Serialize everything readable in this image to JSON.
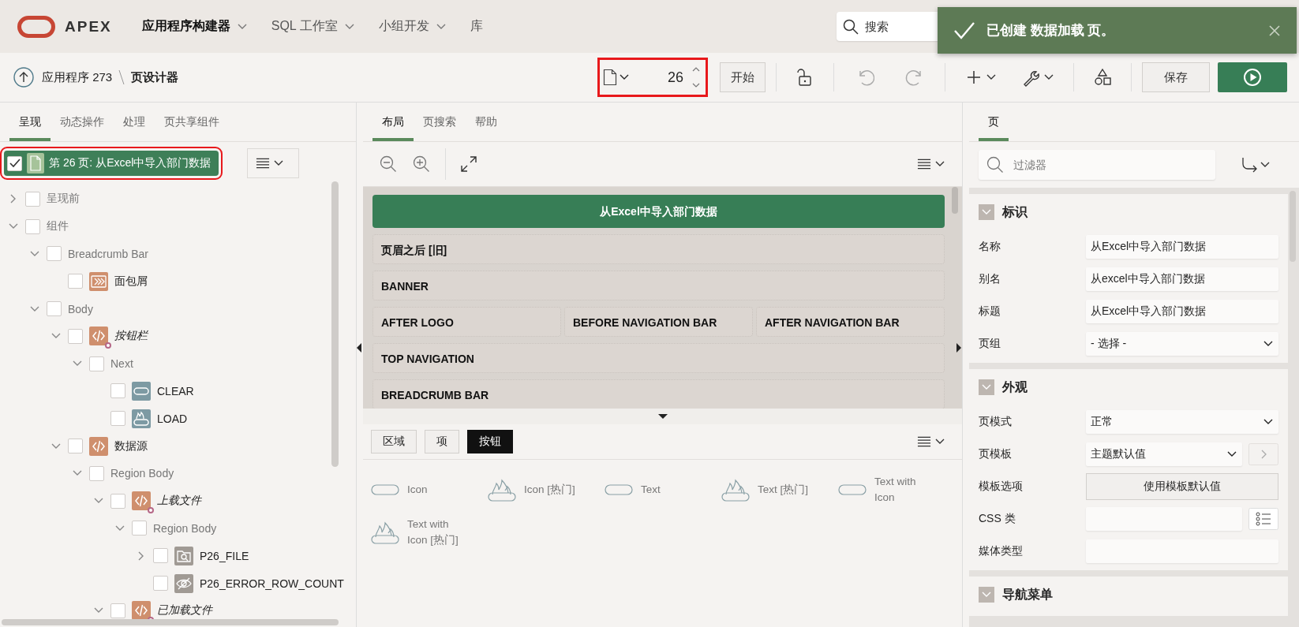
{
  "header": {
    "logo": "APEX",
    "nav": [
      {
        "label": "应用程序构建器",
        "selected": true,
        "menu": true
      },
      {
        "label": "SQL 工作室",
        "selected": false,
        "menu": true
      },
      {
        "label": "小组开发",
        "selected": false,
        "menu": true
      },
      {
        "label": "库",
        "selected": false,
        "menu": false
      }
    ],
    "search": {
      "placeholder": "搜索"
    }
  },
  "toast": {
    "message": "已创建 数据加载 页。"
  },
  "toolbar": {
    "breadcrumb": [
      "应用程序 273",
      "页设计器"
    ],
    "page_number": "26",
    "buttons": [
      {
        "kind": "text",
        "label": "开始"
      },
      {
        "kind": "lock"
      },
      {
        "kind": "undo",
        "disabled": true
      },
      {
        "kind": "redo",
        "disabled": true
      },
      {
        "kind": "add"
      },
      {
        "kind": "wrench"
      },
      {
        "kind": "shapes"
      },
      {
        "kind": "save",
        "label": "保存"
      },
      {
        "kind": "run"
      }
    ]
  },
  "left": {
    "tabs": [
      {
        "label": "呈现",
        "selected": true
      },
      {
        "label": "动态操作",
        "selected": false
      },
      {
        "label": "处理",
        "selected": false
      },
      {
        "label": "页共享组件",
        "selected": false
      }
    ],
    "root": {
      "label": "第 26 页: 从Excel中导入部门数据",
      "checked": true,
      "selected": true,
      "children": [
        {
          "label": "呈现前",
          "kind": "group",
          "checked": false,
          "expanded": false
        },
        {
          "label": "组件",
          "kind": "group",
          "checked": false,
          "expanded": true,
          "children": [
            {
              "label": "Breadcrumb Bar",
              "kind": "group",
              "checked": false,
              "expanded": true,
              "children": [
                {
                  "label": "面包屑",
                  "checked": false,
                  "kind": "breadcrumb"
                }
              ]
            },
            {
              "label": "Body",
              "kind": "group",
              "checked": false,
              "expanded": true,
              "children": [
                {
                  "label": "按钮栏",
                  "checked": false,
                  "expanded": true,
                  "kind": "region",
                  "conditional": true,
                  "children": [
                    {
                      "label": "Next",
                      "kind": "group",
                      "checked": false,
                      "expanded": true,
                      "children": [
                        {
                          "label": "CLEAR",
                          "checked": false,
                          "kind": "button"
                        },
                        {
                          "label": "LOAD",
                          "checked": false,
                          "kind": "hot-button"
                        }
                      ]
                    }
                  ]
                },
                {
                  "label": "数据源",
                  "checked": false,
                  "expanded": true,
                  "kind": "region",
                  "children": [
                    {
                      "label": "Region Body",
                      "kind": "group",
                      "checked": false,
                      "expanded": true,
                      "children": [
                        {
                          "label": "上载文件",
                          "checked": false,
                          "expanded": true,
                          "kind": "region",
                          "conditional": true,
                          "children": [
                            {
                              "label": "Region Body",
                              "kind": "group",
                              "checked": false,
                              "expanded": true,
                              "children": [
                                {
                                  "label": "P26_FILE",
                                  "checked": false,
                                  "expanded": false,
                                  "kind": "file-item"
                                },
                                {
                                  "label": "P26_ERROR_ROW_COUNT",
                                  "checked": false,
                                  "kind": "hidden-item"
                                }
                              ]
                            }
                          ]
                        },
                        {
                          "label": "已加载文件",
                          "checked": false,
                          "expanded": true,
                          "kind": "region",
                          "conditional": true
                        }
                      ]
                    }
                  ]
                }
              ]
            }
          ]
        }
      ]
    }
  },
  "middle": {
    "tabs": [
      {
        "label": "布局",
        "selected": true
      },
      {
        "label": "页搜索",
        "selected": false
      },
      {
        "label": "帮助",
        "selected": false
      }
    ],
    "canvas": {
      "title": "从Excel中导入部门数据",
      "rows": [
        [
          {
            "label": "页眉之后 [旧]"
          }
        ],
        [
          {
            "label": "BANNER"
          }
        ],
        [
          {
            "label": "AFTER LOGO"
          },
          {
            "label": "BEFORE NAVIGATION BAR"
          },
          {
            "label": "AFTER NAVIGATION BAR"
          }
        ],
        [
          {
            "label": "TOP NAVIGATION"
          }
        ],
        [
          {
            "label": "BREADCRUMB BAR"
          }
        ]
      ]
    },
    "gallery": {
      "tabs": [
        {
          "label": "区域",
          "selected": false
        },
        {
          "label": "项",
          "selected": false
        },
        {
          "label": "按钮",
          "selected": true
        }
      ],
      "items": [
        {
          "label": "Icon",
          "kind": "plain"
        },
        {
          "label": "Icon [热门]",
          "kind": "hot"
        },
        {
          "label": "Text",
          "kind": "plain"
        },
        {
          "label": "Text [热门]",
          "kind": "hot"
        },
        {
          "label": "Text with Icon",
          "kind": "plain"
        },
        {
          "label": "Text with Icon [热门]",
          "kind": "hot"
        }
      ]
    }
  },
  "right": {
    "tabs": [
      {
        "label": "页",
        "selected": true
      }
    ],
    "filter": {
      "placeholder": "过滤器"
    },
    "sections": [
      {
        "title": "标识",
        "expanded": true,
        "fields": [
          {
            "label": "名称",
            "kind": "text",
            "value": "从Excel中导入部门数据"
          },
          {
            "label": "别名",
            "kind": "text",
            "value": "从excel中导入部门数据"
          },
          {
            "label": "标题",
            "kind": "text",
            "value": "从Excel中导入部门数据"
          },
          {
            "label": "页组",
            "kind": "select",
            "value": "- 选择 -"
          }
        ]
      },
      {
        "title": "外观",
        "expanded": true,
        "fields": [
          {
            "label": "页模式",
            "kind": "select",
            "value": "正常"
          },
          {
            "label": "页模板",
            "kind": "select-link",
            "value": "主题默认值"
          },
          {
            "label": "模板选项",
            "kind": "button",
            "value": "使用模板默认值"
          },
          {
            "label": "CSS 类",
            "kind": "text-picker"
          },
          {
            "label": "媒体类型",
            "kind": "text"
          }
        ]
      },
      {
        "title": "导航菜单",
        "expanded": true
      }
    ]
  }
}
